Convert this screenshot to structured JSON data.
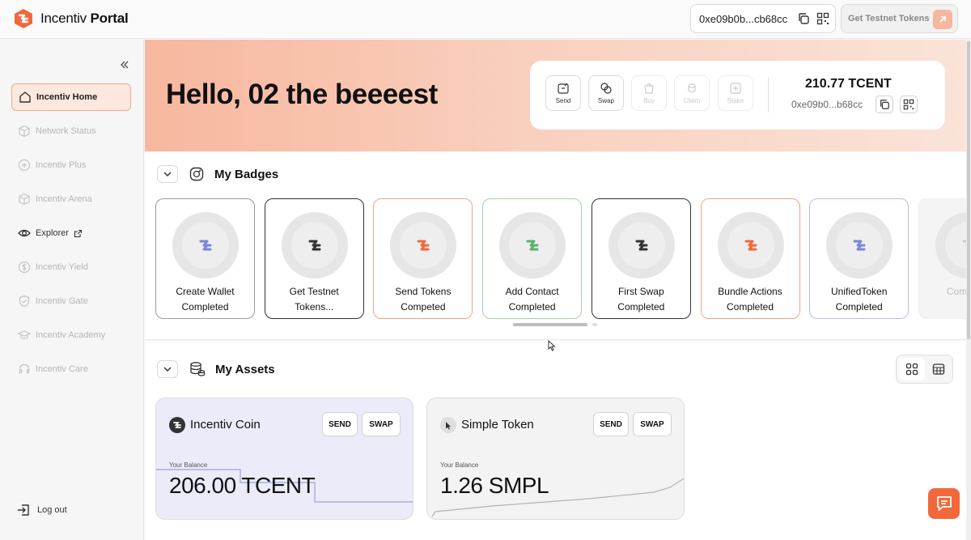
{
  "app": {
    "name_regular": "Incentiv",
    "name_bold": "Portal",
    "brand_color": "#f2683a"
  },
  "topbar": {
    "wallet_address": "0xe09b0b...cb68cc",
    "testnet_label": "Get Testnet Tokens"
  },
  "sidebar": {
    "items": [
      {
        "label": "Incentiv Home",
        "icon": "home-icon",
        "state": "active"
      },
      {
        "label": "Network Status",
        "icon": "cube-icon",
        "state": "disabled"
      },
      {
        "label": "Incentiv Plus",
        "icon": "plus-circle-icon",
        "state": "disabled"
      },
      {
        "label": "Incentiv Arena",
        "icon": "cube-icon",
        "state": "disabled"
      },
      {
        "label": "Explorer",
        "icon": "eye-icon",
        "state": "enabled"
      },
      {
        "label": "Incentiv Yield",
        "icon": "dollar-icon",
        "state": "disabled"
      },
      {
        "label": "Incentiv Gate",
        "icon": "shield-icon",
        "state": "disabled"
      },
      {
        "label": "Incentiv Academy",
        "icon": "graduation-cap-icon",
        "state": "disabled"
      },
      {
        "label": "Incentiv Care",
        "icon": "headset-icon",
        "state": "disabled"
      }
    ],
    "logout_label": "Log out"
  },
  "hero": {
    "greeting": "Hello, 02 the beeeest",
    "actions": [
      {
        "label": "Send",
        "enabled": true
      },
      {
        "label": "Swap",
        "enabled": true
      },
      {
        "label": "Buy",
        "enabled": false
      },
      {
        "label": "Claim",
        "enabled": false
      },
      {
        "label": "Stake",
        "enabled": false
      }
    ],
    "balance": "210.77 TCENT",
    "address": "0xe09b0...b68cc"
  },
  "badges": {
    "title": "My Badges",
    "items": [
      {
        "line1": "Create Wallet",
        "line2": "Completed",
        "color": "#7b86d6",
        "border": "#9a9a9a"
      },
      {
        "line1": "Get Testnet",
        "line2": "Tokens...",
        "color": "#333333",
        "border": "#333333"
      },
      {
        "line1": "Send Tokens",
        "line2": "Competed",
        "color": "#f2683a",
        "border": "#f2a385"
      },
      {
        "line1": "Add Contact",
        "line2": "Completed",
        "color": "#5bb26b",
        "border": "#9fd6a8"
      },
      {
        "line1": "First Swap",
        "line2": "Completed",
        "color": "#333333",
        "border": "#333333"
      },
      {
        "line1": "Bundle Actions",
        "line2": "Completed",
        "color": "#f2683a",
        "border": "#f2a385"
      },
      {
        "line1": "UnifiedToken",
        "line2": "Completed",
        "color": "#7b86d6",
        "border": "#b9bde6"
      },
      {
        "line1": "Com",
        "line2": "",
        "color": "#cccccc",
        "border": "#f0f0f0"
      }
    ]
  },
  "assets": {
    "title": "My Assets",
    "send_label": "SEND",
    "swap_label": "SWAP",
    "balance_label": "Your Balance",
    "items": [
      {
        "name": "Incentiv Coin",
        "amount": "206.00 TCENT",
        "bg": "#ebebfa"
      },
      {
        "name": "Simple Token",
        "amount": "1.26 SMPL",
        "bg": "#f3f3f3"
      }
    ]
  }
}
